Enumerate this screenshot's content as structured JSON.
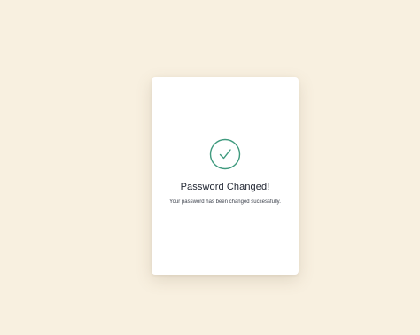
{
  "dialog": {
    "title": "Password Changed!",
    "message": "Your password has been changed successfully.",
    "icon": "check-circle-icon"
  },
  "colors": {
    "background": "#f8f0e0",
    "card": "#ffffff",
    "accent": "#3f9a7e",
    "title_text": "#1f2430",
    "body_text": "#3a3f4a"
  }
}
